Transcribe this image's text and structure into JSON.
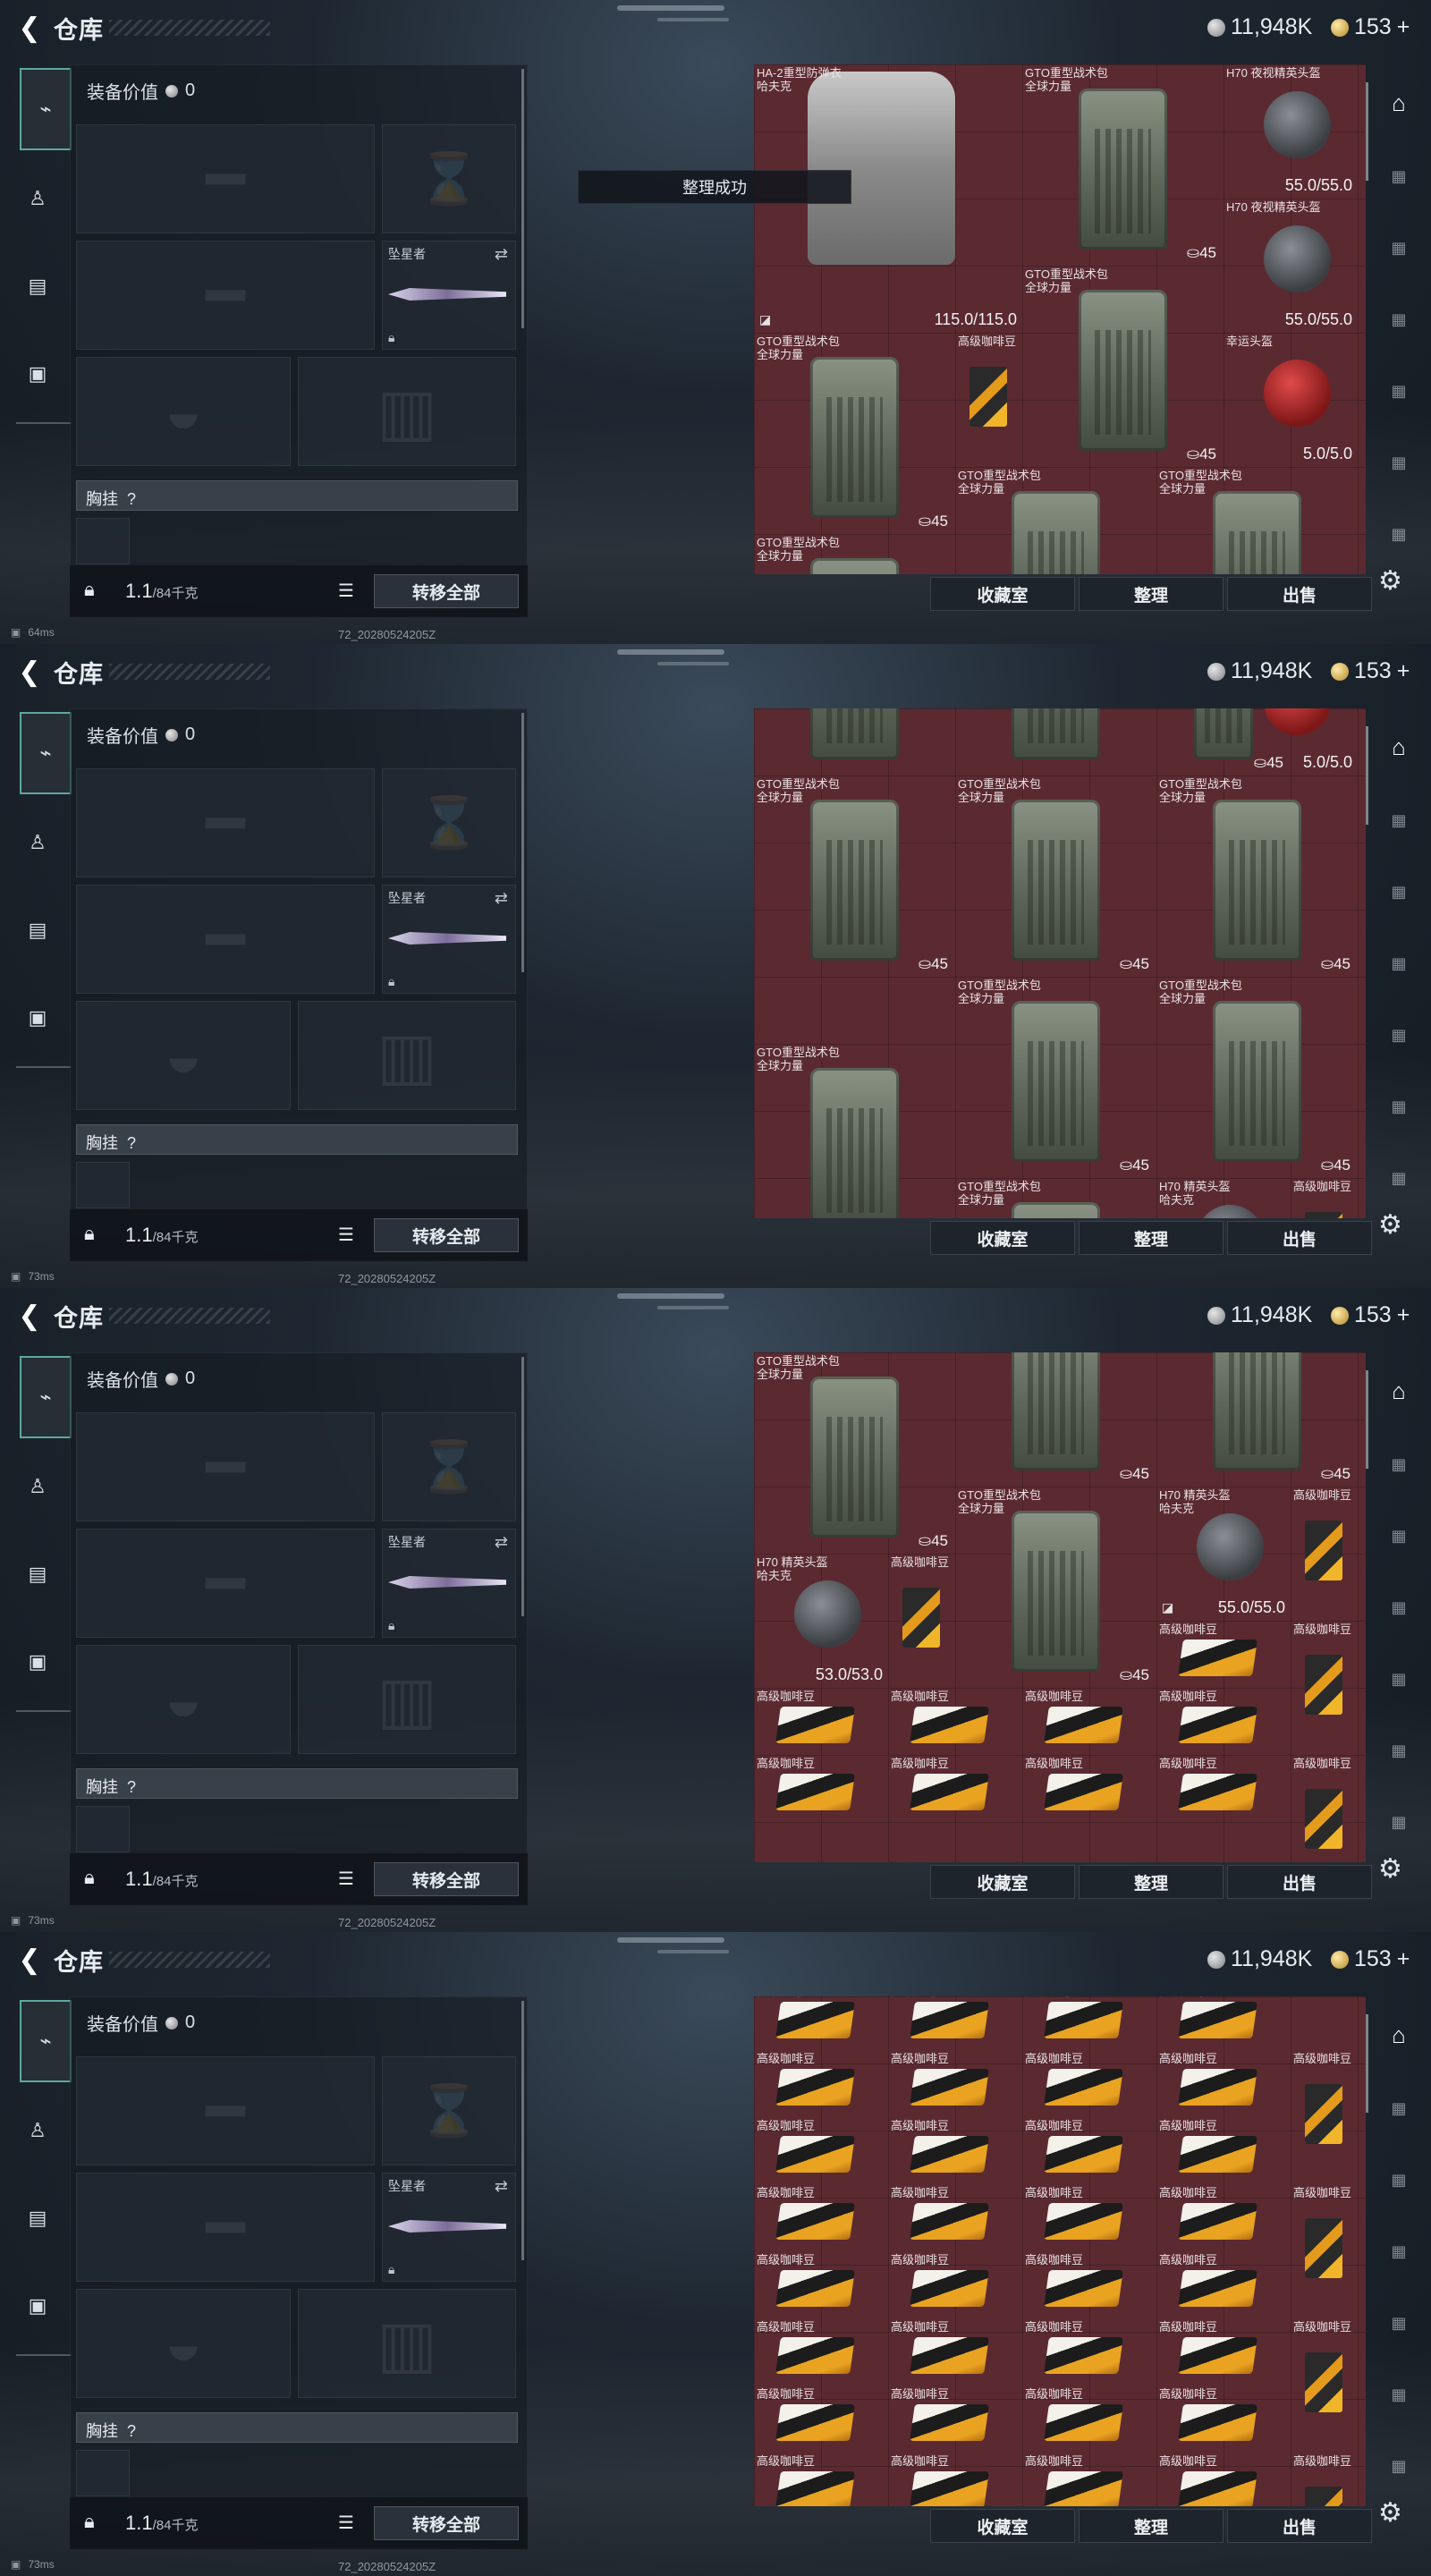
{
  "header": {
    "title": "仓库",
    "currency_silver": "11,948K",
    "currency_gold": "153",
    "plus": "+"
  },
  "equip": {
    "value_label": "装备价值",
    "value": "0",
    "melee_label": "坠星者",
    "chest_label": "胸挂",
    "chest_help": "?",
    "weight": "1.1",
    "weight_cap": "/84千克",
    "transfer_all": "转移全部"
  },
  "tabs": {
    "favorites": "收藏室",
    "organize": "整理",
    "sell": "出售"
  },
  "toast": "整理成功",
  "status": {
    "ping1": "64ms",
    "ping2": "73ms",
    "ping3": "73ms",
    "ping4": "73ms",
    "version": "72_20280524205Z"
  },
  "items": {
    "ha2": "HA-2重型防弹衣\n哈夫克",
    "gto": "GTO重型战术包\n全球力量",
    "h70nv": "H70 夜视精英头盔",
    "h70": "H70 精英头盔\n哈夫克",
    "lucky": "幸运头盔",
    "coffee": "高级咖啡豆",
    "v115": "115.0/115.0",
    "v55": "55.0/55.0",
    "v5": "5.0/5.0",
    "v53": "53.0/53.0",
    "c45": "⛀45"
  },
  "colors": {
    "grid": "#5b2a31",
    "accent": "#5ea7a0"
  }
}
